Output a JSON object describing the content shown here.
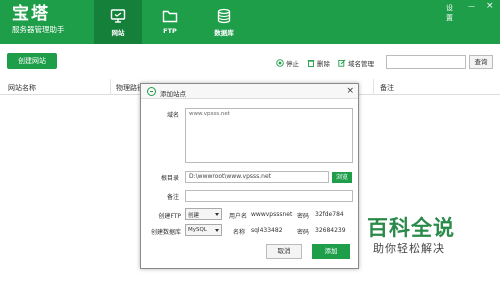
{
  "brand": {
    "title": "宝塔",
    "subtitle": "服务器管理助手"
  },
  "tabs": [
    {
      "label": "网站",
      "icon": "monitor-icon"
    },
    {
      "label": "FTP",
      "icon": "folder-icon"
    },
    {
      "label": "数据库",
      "icon": "database-icon"
    }
  ],
  "window_controls": {
    "settings": "设置",
    "minimize": "—",
    "close": "×"
  },
  "toolbar": {
    "create_label": "创建网站",
    "stop_label": "停止",
    "delete_label": "删除",
    "domain_label": "域名管理",
    "search_label": "查询"
  },
  "table": {
    "headers": [
      "网站名称",
      "物理路径",
      "备注"
    ]
  },
  "dialog": {
    "title": "添加站点",
    "domain_label": "域名",
    "domain_value": "www.vpsss.net",
    "root_label": "根目录",
    "root_value": "D:\\wwwroot\\www.vpsss.net",
    "browse_label": "浏览",
    "note_label": "备注",
    "note_value": "",
    "ftp_label": "创建FTP",
    "ftp_select": "创建",
    "ftp_user_label": "用户名",
    "ftp_user_value": "wwwvpsssnet",
    "ftp_pwd_label": "密码",
    "ftp_pwd_value": "32fde784",
    "db_label": "创建数据库",
    "db_select": "MySQL",
    "db_name_label": "名称",
    "db_name_value": "sql433482",
    "db_pwd_label": "密码",
    "db_pwd_value": "32684239",
    "cancel_label": "取消",
    "add_label": "添加"
  },
  "watermark": {
    "line1": "百科全说",
    "line2": "助你轻松解决"
  },
  "colors": {
    "brand_green": "#1f9e4a",
    "tab_active": "#15803a"
  }
}
